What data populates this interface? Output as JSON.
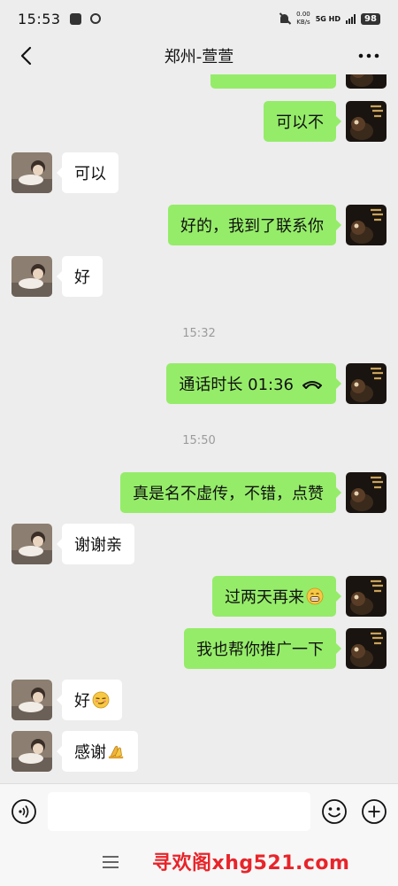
{
  "status_bar": {
    "time": "15:53",
    "net_speed_value": "0.00",
    "net_speed_unit": "KB/s",
    "network": "5G HD",
    "battery": "98"
  },
  "header": {
    "title": "郑州-萱萱"
  },
  "messages": [
    {
      "kind": "out",
      "text": "可以不"
    },
    {
      "kind": "in",
      "text": "可以"
    },
    {
      "kind": "out",
      "text": "好的，我到了联系你"
    },
    {
      "kind": "in",
      "text": "好"
    },
    {
      "kind": "time",
      "text": "15:32"
    },
    {
      "kind": "out",
      "text": "通话时长 01:36",
      "icon": "phone-hangup-icon"
    },
    {
      "kind": "time",
      "text": "15:50"
    },
    {
      "kind": "out",
      "text": "真是名不虚传，不错，点赞"
    },
    {
      "kind": "in",
      "text": "谢谢亲"
    },
    {
      "kind": "out",
      "text": "过两天再来",
      "emoji": "grin-emoji"
    },
    {
      "kind": "out",
      "text": "我也帮你推广一下"
    },
    {
      "kind": "in",
      "text": "好",
      "emoji": "smirk-emoji"
    },
    {
      "kind": "in",
      "text": "感谢",
      "emoji": "pray-emoji"
    }
  ],
  "input_bar": {
    "placeholder": ""
  },
  "watermark": {
    "text": "寻欢阁xhg521.com"
  },
  "colors": {
    "background": "#ededed",
    "outgoing_bubble": "#95ec69",
    "incoming_bubble": "#ffffff",
    "timestamp": "#9b9b9b",
    "watermark": "#e8242a"
  }
}
